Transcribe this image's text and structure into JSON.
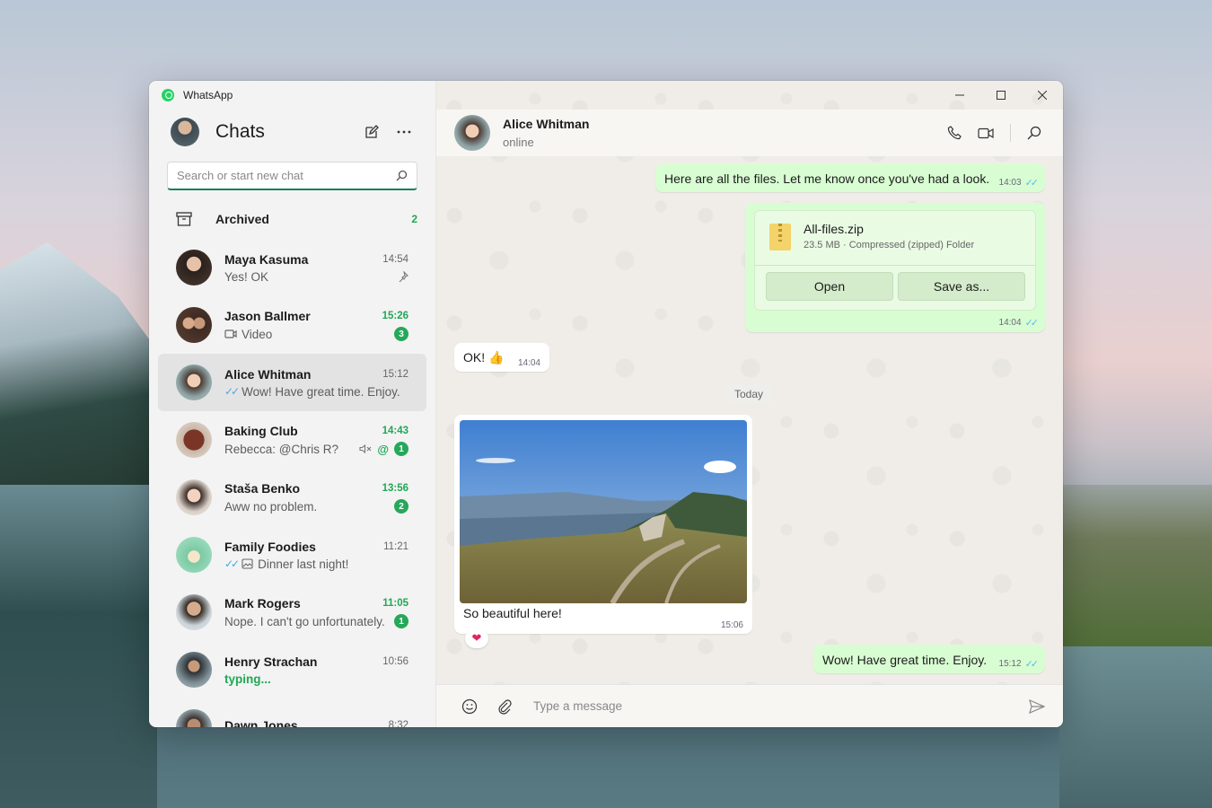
{
  "app": {
    "title": "WhatsApp"
  },
  "sidebar": {
    "title": "Chats",
    "search_placeholder": "Search or start new chat",
    "archived": {
      "label": "Archived",
      "count": "2"
    },
    "chats": [
      {
        "name": "Maya Kasuma",
        "time": "14:54",
        "preview": "Yes! OK",
        "pinned": true,
        "avatar_color": "#7a5a4a"
      },
      {
        "name": "Jason Ballmer",
        "time": "15:26",
        "preview": "Video",
        "unread": "3",
        "avatar_color": "#6b4b3a"
      },
      {
        "name": "Alice Whitman",
        "time": "15:12",
        "preview": "Wow! Have great time. Enjoy.",
        "avatar_color": "#8a7060"
      },
      {
        "name": "Baking Club",
        "time": "14:43",
        "preview": "Rebecca: @Chris R?",
        "unread": "1",
        "avatar_color": "#7b3b2a"
      },
      {
        "name": "Staša Benko",
        "time": "13:56",
        "preview": "Aww no problem.",
        "unread": "2",
        "avatar_color": "#b79a88"
      },
      {
        "name": "Family Foodies",
        "time": "11:21",
        "preview": "Dinner last night!",
        "avatar_color": "#a9e4c9"
      },
      {
        "name": "Mark Rogers",
        "time": "11:05",
        "preview": "Nope. I can't go unfortunately.",
        "unread": "1",
        "avatar_color": "#5d4a3a"
      },
      {
        "name": "Henry Strachan",
        "time": "10:56",
        "preview": "typing...",
        "avatar_color": "#3d4850"
      },
      {
        "name": "Dawn Jones",
        "time": "8:32",
        "preview": "",
        "avatar_color": "#6a5a55"
      }
    ]
  },
  "conversation": {
    "name": "Alice Whitman",
    "status": "online",
    "messages": {
      "m1": {
        "text": "Here are all the files. Let me know once you've had a look.",
        "time": "14:03"
      },
      "file": {
        "name": "All-files.zip",
        "meta": "23.5 MB · Compressed (zipped) Folder",
        "open": "Open",
        "save": "Save as...",
        "time": "14:04"
      },
      "m2": {
        "text": "OK! 👍",
        "time": "14:04"
      },
      "date": "Today",
      "photo": {
        "caption": "So beautiful here!",
        "time": "15:06",
        "reaction": "❤"
      },
      "m3": {
        "text": "Wow! Have great time. Enjoy.",
        "time": "15:12"
      }
    },
    "composer_placeholder": "Type a message"
  },
  "colors": {
    "accent": "#25d366",
    "unread": "#1fa855",
    "outgoing": "#d9fdd3"
  }
}
